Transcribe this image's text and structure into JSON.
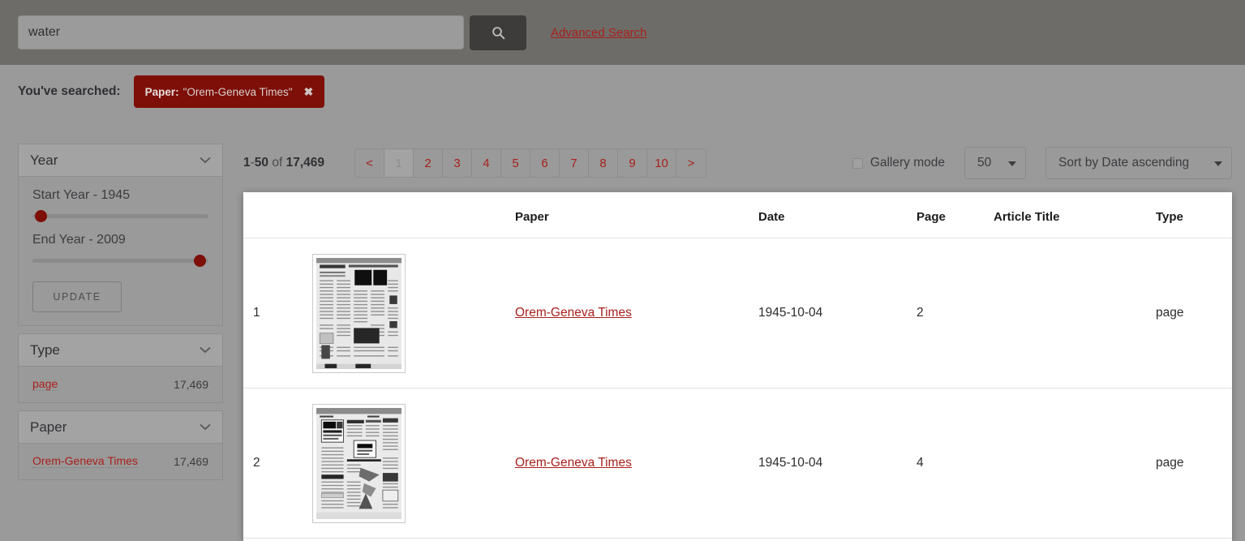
{
  "search": {
    "query_value": "water",
    "placeholder": "Search",
    "search_button_icon": "search-icon",
    "advanced_search_label": "Advanced Search"
  },
  "searched_bar": {
    "label": "You've searched:",
    "chips": [
      {
        "key": "Paper:",
        "value": "\"Orem-Geneva Times\"",
        "remove_icon": "close-icon"
      }
    ]
  },
  "sidebar": {
    "facets": [
      {
        "title": "Year",
        "chevron_icon": "chevron-down-icon",
        "start_label": "Start Year - 1945",
        "end_label": "End Year - 2009",
        "start_year": 1945,
        "end_year": 2009,
        "update_label": "UPDATE"
      },
      {
        "title": "Type",
        "chevron_icon": "chevron-down-icon",
        "terms": [
          {
            "label": "page",
            "count": "17,469"
          }
        ]
      },
      {
        "title": "Paper",
        "chevron_icon": "chevron-down-icon",
        "terms": [
          {
            "label": "Orem-Geneva Times",
            "count": "17,469"
          }
        ]
      }
    ]
  },
  "controls": {
    "range_start": "1",
    "range_dash": "-",
    "range_end": "50",
    "of_word": "of",
    "total": "17,469",
    "pager": {
      "prev": "<",
      "pages": [
        "1",
        "2",
        "3",
        "4",
        "5",
        "6",
        "7",
        "8",
        "9",
        "10"
      ],
      "active_page": "1",
      "next": ">"
    },
    "gallery_mode_label": "Gallery mode",
    "gallery_mode_checked": false,
    "page_size_value": "50",
    "sort_value": "Sort by Date ascending"
  },
  "results": {
    "columns": [
      "",
      "",
      "Paper",
      "Date",
      "Page",
      "Article Title",
      "Type"
    ],
    "rows": [
      {
        "index": "1",
        "thumbnail": "newspaper-page-thumbnail",
        "paper": "Orem-Geneva Times",
        "date": "1945-10-04",
        "page": "2",
        "article_title": "",
        "type": "page"
      },
      {
        "index": "2",
        "thumbnail": "newspaper-page-thumbnail",
        "paper": "Orem-Geneva Times",
        "date": "1945-10-04",
        "page": "4",
        "article_title": "",
        "type": "page"
      }
    ]
  },
  "colors": {
    "accent_red": "#a8201c",
    "chip_red": "#7d0f08",
    "header_bg": "#6e6c68",
    "page_bg": "#9a9a9a"
  }
}
